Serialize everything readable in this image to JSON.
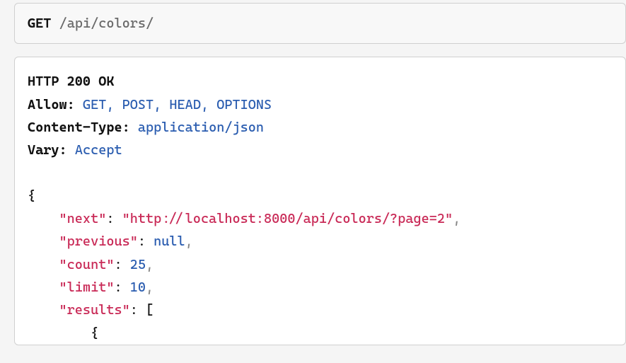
{
  "request": {
    "method": "GET",
    "path_segments": [
      "api",
      "colors"
    ]
  },
  "response": {
    "status_line": "HTTP 200 OK",
    "headers": {
      "allow_key": "Allow",
      "allow_val": "GET, POST, HEAD, OPTIONS",
      "content_type_key": "Content-Type",
      "content_type_val": "application/json",
      "vary_key": "Vary",
      "vary_val": "Accept"
    },
    "body": {
      "next_key": "\"next\"",
      "next_val": "\"http://localhost:8000/api/colors/?page=2\"",
      "previous_key": "\"previous\"",
      "previous_val": "null",
      "count_key": "\"count\"",
      "count_val": "25",
      "limit_key": "\"limit\"",
      "limit_val": "10",
      "results_key": "\"results\""
    }
  }
}
